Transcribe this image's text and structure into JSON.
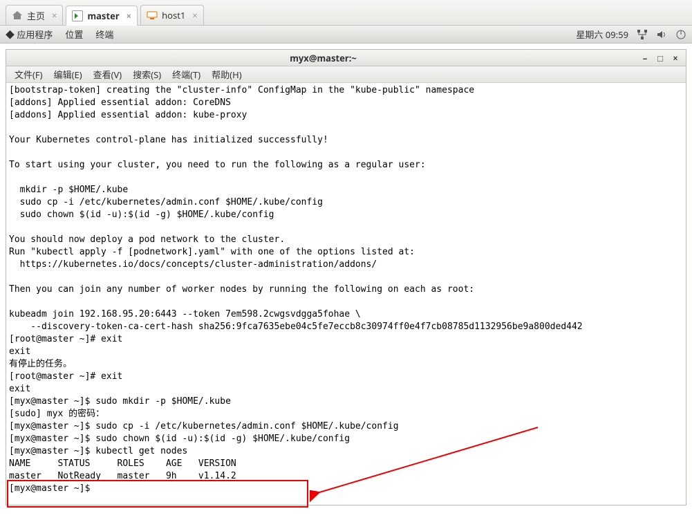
{
  "tabs": [
    {
      "id": "home",
      "label": "主页",
      "active": false
    },
    {
      "id": "master",
      "label": "master",
      "active": true
    },
    {
      "id": "host1",
      "label": "host1",
      "active": false
    }
  ],
  "panel": {
    "apps": "应用程序",
    "places": "位置",
    "terminal": "终端",
    "clock": "星期六 09:59"
  },
  "window": {
    "title": "myx@master:~",
    "menus": {
      "file": "文件(F)",
      "edit": "编辑(E)",
      "view": "查看(V)",
      "search": "搜索(S)",
      "terminal": "终端(T)",
      "help": "帮助(H)"
    }
  },
  "terminal_lines": [
    "[bootstrap-token] creating the \"cluster-info\" ConfigMap in the \"kube-public\" namespace",
    "[addons] Applied essential addon: CoreDNS",
    "[addons] Applied essential addon: kube-proxy",
    "",
    "Your Kubernetes control-plane has initialized successfully!",
    "",
    "To start using your cluster, you need to run the following as a regular user:",
    "",
    "  mkdir -p $HOME/.kube",
    "  sudo cp -i /etc/kubernetes/admin.conf $HOME/.kube/config",
    "  sudo chown $(id -u):$(id -g) $HOME/.kube/config",
    "",
    "You should now deploy a pod network to the cluster.",
    "Run \"kubectl apply -f [podnetwork].yaml\" with one of the options listed at:",
    "  https://kubernetes.io/docs/concepts/cluster-administration/addons/",
    "",
    "Then you can join any number of worker nodes by running the following on each as root:",
    "",
    "kubeadm join 192.168.95.20:6443 --token 7em598.2cwgsvdgga5fohae \\",
    "    --discovery-token-ca-cert-hash sha256:9fca7635ebe04c5fe7eccb8c30974ff0e4f7cb08785d1132956be9a800ded442",
    "[root@master ~]# exit",
    "exit",
    "有停止的任务。",
    "[root@master ~]# exit",
    "exit",
    "[myx@master ~]$ sudo mkdir -p $HOME/.kube",
    "[sudo] myx 的密码：",
    "[myx@master ~]$ sudo cp -i /etc/kubernetes/admin.conf $HOME/.kube/config",
    "[myx@master ~]$ sudo chown $(id -u):$(id -g) $HOME/.kube/config",
    "[myx@master ~]$ kubectl get nodes",
    "NAME     STATUS     ROLES    AGE   VERSION",
    "master   NotReady   master   9h    v1.14.2",
    "[myx@master ~]$ "
  ]
}
